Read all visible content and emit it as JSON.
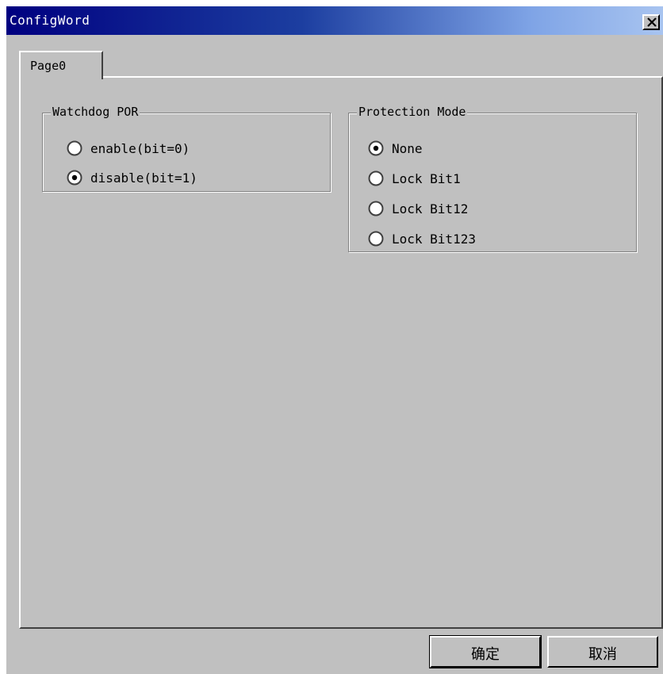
{
  "window": {
    "title": "ConfigWord"
  },
  "tabs": [
    {
      "label": "Page0",
      "selected": true
    }
  ],
  "watchdog_group": {
    "title": "Watchdog POR",
    "options": [
      {
        "label": "enable(bit=0)",
        "selected": false
      },
      {
        "label": "disable(bit=1)",
        "selected": true
      }
    ]
  },
  "protection_group": {
    "title": "Protection Mode",
    "options": [
      {
        "label": "None",
        "selected": true
      },
      {
        "label": "Lock Bit1",
        "selected": false
      },
      {
        "label": "Lock Bit12",
        "selected": false
      },
      {
        "label": "Lock Bit123",
        "selected": false
      }
    ]
  },
  "buttons": {
    "ok_label": "确定",
    "cancel_label": "取消"
  },
  "colors": {
    "titlebar_start": "#000080",
    "titlebar_end": "#a8c4f0",
    "face": "#c0c0c0"
  }
}
